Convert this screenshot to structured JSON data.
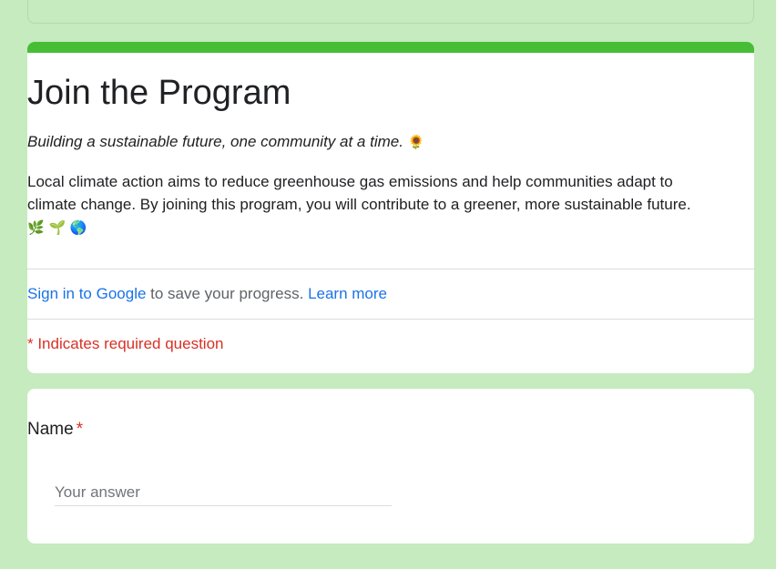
{
  "form": {
    "title": "Join the Program",
    "tagline": "Building a sustainable future, one community at a time.",
    "tagline_emoji": "🌻",
    "description": "Local climate action aims to reduce greenhouse gas emissions and help communities adapt to climate change. By joining this program, you will contribute to a greener, more sustainable future.",
    "description_emojis": "🌿 🌱 🌎",
    "accent_color": "#46bd34",
    "background_color": "#c5ebbe"
  },
  "signin": {
    "link_label": "Sign in to Google",
    "text": " to save your progress. ",
    "learn_more_label": "Learn more"
  },
  "required_note": "* Indicates required question",
  "questions": [
    {
      "label": "Name",
      "required_marker": "*",
      "placeholder": "Your answer",
      "value": ""
    }
  ]
}
